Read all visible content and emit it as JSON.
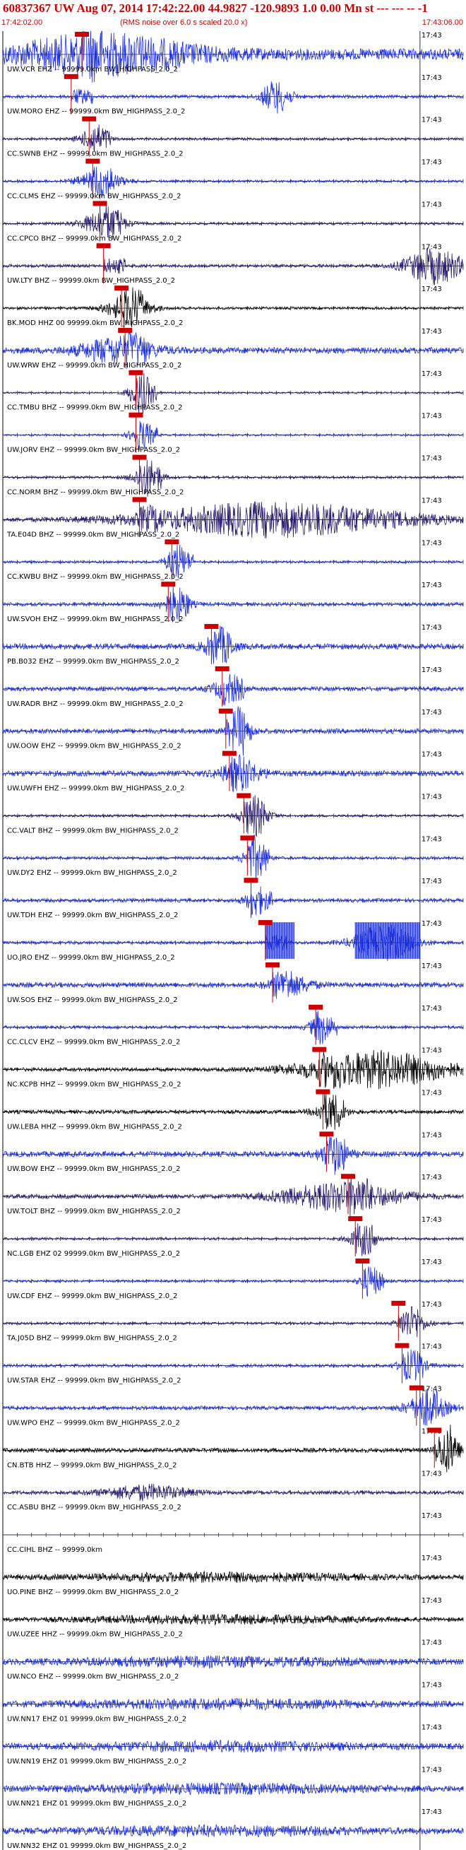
{
  "header": {
    "title": "60837367 UW Aug 07, 2014 17:42:22.00   44.9827 -120.9893  1.0 0.00 Mn st --- --- --   -1",
    "start_time": "17:42:02.00",
    "end_time": "17:43:06.00",
    "rms_note": "(RMS noise over 6.0 s scaled 20.0 x)"
  },
  "colors": {
    "blue": "#1b2fe0",
    "navy": "#2a1a70",
    "black": "#000000",
    "pick": "#cc0000",
    "grid": "#000000"
  },
  "chart_data": {
    "type": "line",
    "x_unit": "time (17:42:02.00 to 17:43:06.00)",
    "minute_tick_label": "17:43",
    "trace_count": 42,
    "traces": [
      {
        "label": "UW.VCR EHZ -- 99999.0km BW_HIGHPASS_2.0_2",
        "color": "blue",
        "amplitude": 0.9,
        "pick_time": 11.0,
        "burst_center": 14.0,
        "burst_width": 12.0,
        "burst_amp": 1.0
      },
      {
        "label": "UW.MORO EHZ -- 99999.0km BW_HIGHPASS_2.0_2",
        "color": "blue",
        "amplitude": 0.25,
        "pick_time": 9.5,
        "burst_center": 38.0,
        "burst_width": 2.0,
        "burst_amp": 0.9
      },
      {
        "label": "CC.SWNB EHZ -- 99999.0km BW_HIGHPASS_2.0_2",
        "color": "navy",
        "amplitude": 0.2,
        "pick_time": 12.0,
        "burst_center": 12.5,
        "burst_width": 2.0,
        "burst_amp": 0.5
      },
      {
        "label": "CC.CLMS EHZ -- 99999.0km BW_HIGHPASS_2.0_2",
        "color": "blue",
        "amplitude": 0.2,
        "pick_time": 12.5,
        "burst_center": 13.5,
        "burst_width": 3.0,
        "burst_amp": 0.6
      },
      {
        "label": "CC.CPCO BHZ -- 99999.0km BW_HIGHPASS_2.0_2",
        "color": "navy",
        "amplitude": 0.2,
        "pick_time": 13.5,
        "burst_center": 14.0,
        "burst_width": 3.0,
        "burst_amp": 0.7
      },
      {
        "label": "UW.LTY BHZ -- 99999.0km BW_HIGHPASS_2.0_2",
        "color": "navy",
        "amplitude": 0.25,
        "pick_time": 14.0,
        "burst_center": 60.0,
        "burst_width": 4.0,
        "burst_amp": 1.0
      },
      {
        "label": "BK.MOD HHZ 00 99999.0km BW_HIGHPASS_2.0_2",
        "color": "black",
        "amplitude": 0.2,
        "pick_time": 16.5,
        "burst_center": 17.5,
        "burst_width": 3.0,
        "burst_amp": 0.8
      },
      {
        "label": "UW.WRW EHZ -- 99999.0km BW_HIGHPASS_2.0_2",
        "color": "blue",
        "amplitude": 0.5,
        "pick_time": 17.0,
        "burst_center": 16.0,
        "burst_width": 5.0,
        "burst_amp": 0.7
      },
      {
        "label": "CC.TMBU BHZ -- 99999.0km BW_HIGHPASS_2.0_2",
        "color": "navy",
        "amplitude": 0.15,
        "pick_time": 18.5,
        "burst_center": 19.0,
        "burst_width": 1.5,
        "burst_amp": 0.9
      },
      {
        "label": "UW.JORV EHZ -- 99999.0km BW_HIGHPASS_2.0_2",
        "color": "blue",
        "amplitude": 0.15,
        "pick_time": 18.5,
        "burst_center": 19.0,
        "burst_width": 1.5,
        "burst_amp": 0.5
      },
      {
        "label": "CC.NORM BHZ -- 99999.0km BW_HIGHPASS_2.0_2",
        "color": "navy",
        "amplitude": 0.2,
        "pick_time": 19.0,
        "burst_center": 20.0,
        "burst_width": 2.0,
        "burst_amp": 0.7
      },
      {
        "label": "TA.E04D BHZ -- 99999.0km BW_HIGHPASS_2.0_2",
        "color": "navy",
        "amplitude": 0.3,
        "pick_time": 19.0,
        "burst_center": 38.0,
        "burst_width": 18.0,
        "burst_amp": 0.95
      },
      {
        "label": "CC.KWBU BHZ -- 99999.0km BW_HIGHPASS_2.0_2",
        "color": "blue",
        "amplitude": 0.2,
        "pick_time": 23.5,
        "burst_center": 24.0,
        "burst_width": 1.5,
        "burst_amp": 0.7
      },
      {
        "label": "UW.SVOH EHZ -- 99999.0km BW_HIGHPASS_2.0_2",
        "color": "blue",
        "amplitude": 0.3,
        "pick_time": 23.0,
        "burst_center": 24.0,
        "burst_width": 2.0,
        "burst_amp": 0.6
      },
      {
        "label": "PB.B032 EHZ -- 99999.0km BW_HIGHPASS_2.0_2",
        "color": "blue",
        "amplitude": 0.45,
        "pick_time": 29.0,
        "burst_center": 30.0,
        "burst_width": 2.0,
        "burst_amp": 0.7
      },
      {
        "label": "UW.RADR BHZ -- 99999.0km BW_HIGHPASS_2.0_2",
        "color": "blue",
        "amplitude": 0.35,
        "pick_time": 30.5,
        "burst_center": 31.0,
        "burst_width": 2.0,
        "burst_amp": 0.5
      },
      {
        "label": "UW.OOW EHZ -- 99999.0km BW_HIGHPASS_2.0_2",
        "color": "blue",
        "amplitude": 0.4,
        "pick_time": 31.0,
        "burst_center": 33.0,
        "burst_width": 1.5,
        "burst_amp": 1.0
      },
      {
        "label": "UW.UWFH EHZ -- 99999.0km BW_HIGHPASS_2.0_2",
        "color": "blue",
        "amplitude": 0.45,
        "pick_time": 31.5,
        "burst_center": 33.0,
        "burst_width": 3.0,
        "burst_amp": 0.6
      },
      {
        "label": "CC.VALT BHZ -- 99999.0km BW_HIGHPASS_2.0_2",
        "color": "navy",
        "amplitude": 0.2,
        "pick_time": 33.5,
        "burst_center": 35.0,
        "burst_width": 2.0,
        "burst_amp": 0.8
      },
      {
        "label": "UW.DY2 EHZ -- 99999.0km BW_HIGHPASS_2.0_2",
        "color": "blue",
        "amplitude": 0.25,
        "pick_time": 34.0,
        "burst_center": 35.0,
        "burst_width": 1.5,
        "burst_amp": 0.9
      },
      {
        "label": "UW.TDH EHZ -- 99999.0km BW_HIGHPASS_2.0_2",
        "color": "blue",
        "amplitude": 0.3,
        "pick_time": 34.5,
        "burst_center": 35.0,
        "burst_width": 1.5,
        "burst_amp": 0.5
      },
      {
        "label": "UO.JRO EHZ -- 99999.0km BW_HIGHPASS_2.0_2",
        "color": "blue",
        "amplitude": 0.25,
        "pick_time": 36.5,
        "burst_center": 53.0,
        "burst_width": 4.0,
        "burst_amp": 1.0,
        "clipped": [
          [
            36.5,
            40.5
          ],
          [
            49.0,
            58.0
          ]
        ]
      },
      {
        "label": "UW.SOS EHZ -- 99999.0km BW_HIGHPASS_2.0_2",
        "color": "blue",
        "amplitude": 0.4,
        "pick_time": 37.5,
        "burst_center": 40.0,
        "burst_width": 3.0,
        "burst_amp": 0.5
      },
      {
        "label": "CC.CLCV EHZ -- 99999.0km BW_HIGHPASS_2.0_2",
        "color": "blue",
        "amplitude": 0.25,
        "pick_time": 43.5,
        "burst_center": 44.0,
        "burst_width": 1.5,
        "burst_amp": 0.6
      },
      {
        "label": "NC.KCPB HHZ -- 99999.0km BW_HIGHPASS_2.0_2",
        "color": "black",
        "amplitude": 0.3,
        "pick_time": 44.0,
        "burst_center": 52.0,
        "burst_width": 10.0,
        "burst_amp": 1.0
      },
      {
        "label": "UW.LEBA HHZ -- 99999.0km BW_HIGHPASS_2.0_2",
        "color": "black",
        "amplitude": 0.3,
        "pick_time": 44.5,
        "burst_center": 45.5,
        "burst_width": 2.0,
        "burst_amp": 0.7
      },
      {
        "label": "UW.BOW EHZ -- 99999.0km BW_HIGHPASS_2.0_2",
        "color": "blue",
        "amplitude": 0.45,
        "pick_time": 45.0,
        "burst_center": 46.0,
        "burst_width": 2.0,
        "burst_amp": 0.7
      },
      {
        "label": "UW.TOLT BHZ -- 99999.0km BW_HIGHPASS_2.0_2",
        "color": "navy",
        "amplitude": 0.35,
        "pick_time": 48.0,
        "burst_center": 47.0,
        "burst_width": 8.0,
        "burst_amp": 0.8
      },
      {
        "label": "NC.LGB EHZ 02 99999.0km BW_HIGHPASS_2.0_2",
        "color": "navy",
        "amplitude": 0.2,
        "pick_time": 49.0,
        "burst_center": 50.0,
        "burst_width": 2.0,
        "burst_amp": 0.6
      },
      {
        "label": "UW.CDF EHZ -- 99999.0km BW_HIGHPASS_2.0_2",
        "color": "blue",
        "amplitude": 0.2,
        "pick_time": 50.0,
        "burst_center": 51.0,
        "burst_width": 1.5,
        "burst_amp": 0.5
      },
      {
        "label": "TA.J05D BHZ -- 99999.0km BW_HIGHPASS_2.0_2",
        "color": "navy",
        "amplitude": 0.2,
        "pick_time": 55.0,
        "burst_center": 57.0,
        "burst_width": 2.0,
        "burst_amp": 0.6
      },
      {
        "label": "UW.STAR EHZ -- 99999.0km BW_HIGHPASS_2.0_2",
        "color": "blue",
        "amplitude": 0.25,
        "pick_time": 55.5,
        "burst_center": 57.0,
        "burst_width": 2.0,
        "burst_amp": 0.5
      },
      {
        "label": "UW.WPO EHZ -- 99999.0km BW_HIGHPASS_2.0_2",
        "color": "blue",
        "amplitude": 0.3,
        "pick_time": 57.5,
        "burst_center": 59.0,
        "burst_width": 3.0,
        "burst_amp": 0.7
      },
      {
        "label": "CN.BTB HHZ -- 99999.0km BW_HIGHPASS_2.0_2",
        "color": "black",
        "amplitude": 0.35,
        "pick_time": 60.0,
        "burst_center": 62.0,
        "burst_width": 1.5,
        "burst_amp": 1.0
      },
      {
        "label": "CC.ASBU BHZ -- 99999.0km BW_HIGHPASS_2.0_2",
        "color": "navy",
        "amplitude": 0.3,
        "pick_time": null,
        "burst_center": 20.0,
        "burst_width": 6.0,
        "burst_amp": 0.4
      },
      {
        "label": "CC.CIHL BHZ -- 99999.0km",
        "color": "navy",
        "amplitude": 0.0,
        "pick_time": null,
        "burst_center": 0,
        "burst_width": 1,
        "burst_amp": 0.0
      },
      {
        "label": "UO.PINE BHZ -- 99999.0km BW_HIGHPASS_2.0_2",
        "color": "black",
        "amplitude": 0.35,
        "pick_time": null,
        "burst_center": 30.0,
        "burst_width": 20.0,
        "burst_amp": 0.2
      },
      {
        "label": "UW.UZEE HHZ -- 99999.0km BW_HIGHPASS_2.0_2",
        "color": "black",
        "amplitude": 0.3,
        "pick_time": null,
        "burst_center": 30.0,
        "burst_width": 20.0,
        "burst_amp": 0.2
      },
      {
        "label": "UW.NCO EHZ -- 99999.0km BW_HIGHPASS_2.0_2",
        "color": "blue",
        "amplitude": 0.45,
        "pick_time": null,
        "burst_center": 30.0,
        "burst_width": 20.0,
        "burst_amp": 0.2
      },
      {
        "label": "UW.NN17 EHZ 01 99999.0km BW_HIGHPASS_2.0_2",
        "color": "blue",
        "amplitude": 0.45,
        "pick_time": null,
        "burst_center": 30.0,
        "burst_width": 20.0,
        "burst_amp": 0.2
      },
      {
        "label": "UW.NN19 EHZ 01 99999.0km BW_HIGHPASS_2.0_2",
        "color": "blue",
        "amplitude": 0.45,
        "pick_time": null,
        "burst_center": 30.0,
        "burst_width": 20.0,
        "burst_amp": 0.2
      },
      {
        "label": "UW.NN21 EHZ 01 99999.0km BW_HIGHPASS_2.0_2",
        "color": "blue",
        "amplitude": 0.45,
        "pick_time": null,
        "burst_center": 30.0,
        "burst_width": 20.0,
        "burst_amp": 0.2
      },
      {
        "label": "UW.NN32 EHZ 01 99999.0km BW_HIGHPASS_2.0_2",
        "color": "blue",
        "amplitude": 0.45,
        "pick_time": null,
        "burst_center": 30.0,
        "burst_width": 20.0,
        "burst_amp": 0.2
      }
    ],
    "x_range": [
      0,
      64
    ],
    "minute_tick_at": 58,
    "tick_interval": 2
  }
}
